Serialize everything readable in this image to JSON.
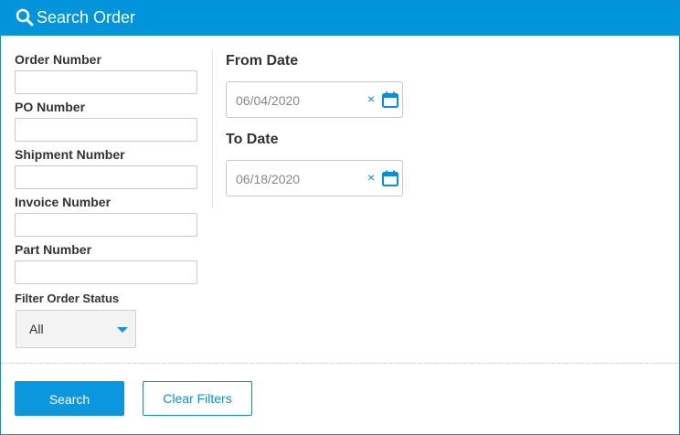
{
  "header": {
    "title": "Search Order",
    "icon": "search-icon"
  },
  "fields": [
    {
      "label": "Order Number",
      "value": ""
    },
    {
      "label": "PO Number",
      "value": ""
    },
    {
      "label": "Shipment Number",
      "value": ""
    },
    {
      "label": "Invoice Number",
      "value": ""
    },
    {
      "label": "Part Number",
      "value": ""
    }
  ],
  "status_filter": {
    "label": "Filter Order Status",
    "selected": "All"
  },
  "dates": {
    "from": {
      "label": "From Date",
      "value": "06/04/2020",
      "clear": "×"
    },
    "to": {
      "label": "To Date",
      "value": "06/18/2020",
      "clear": "×"
    }
  },
  "actions": {
    "search": "Search",
    "clear_filters": "Clear Filters"
  },
  "colors": {
    "accent": "#0095da",
    "border": "#c8c8c8"
  }
}
